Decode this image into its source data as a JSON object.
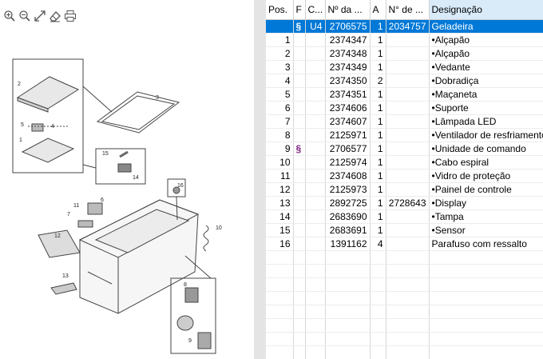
{
  "toolbar": {
    "icons": [
      "zoom-in-icon",
      "zoom-out-icon",
      "fit-icon",
      "eraser-icon",
      "print-icon"
    ]
  },
  "drawing": {
    "labels": [
      "2",
      "3",
      "5",
      "4",
      "1",
      "15",
      "14",
      "16",
      "6",
      "11",
      "7",
      "12",
      "10",
      "13",
      "8",
      "9"
    ]
  },
  "table": {
    "headers": [
      "Pos.",
      "F",
      "C...",
      "Nº da ...",
      "A",
      "N° de ...",
      "Designação"
    ],
    "rows": [
      {
        "pos": "",
        "f": "§",
        "c": "U4",
        "num": "2706575",
        "a": "1",
        "n2": "2034757",
        "desc": "Geladeira",
        "sel": true
      },
      {
        "pos": "1",
        "f": "",
        "c": "",
        "num": "2374347",
        "a": "1",
        "n2": "",
        "desc": "•Alçapão"
      },
      {
        "pos": "2",
        "f": "",
        "c": "",
        "num": "2374348",
        "a": "1",
        "n2": "",
        "desc": "•Alçapão"
      },
      {
        "pos": "3",
        "f": "",
        "c": "",
        "num": "2374349",
        "a": "1",
        "n2": "",
        "desc": "•Vedante"
      },
      {
        "pos": "4",
        "f": "",
        "c": "",
        "num": "2374350",
        "a": "2",
        "n2": "",
        "desc": "•Dobradiça"
      },
      {
        "pos": "5",
        "f": "",
        "c": "",
        "num": "2374351",
        "a": "1",
        "n2": "",
        "desc": "•Maçaneta"
      },
      {
        "pos": "6",
        "f": "",
        "c": "",
        "num": "2374606",
        "a": "1",
        "n2": "",
        "desc": "•Suporte"
      },
      {
        "pos": "7",
        "f": "",
        "c": "",
        "num": "2374607",
        "a": "1",
        "n2": "",
        "desc": "•Lâmpada LED"
      },
      {
        "pos": "8",
        "f": "",
        "c": "",
        "num": "2125971",
        "a": "1",
        "n2": "",
        "desc": "•Ventilador de resfriamento"
      },
      {
        "pos": "9",
        "f": "§",
        "c": "",
        "num": "2706577",
        "a": "1",
        "n2": "",
        "desc": "•Unidade de comando"
      },
      {
        "pos": "10",
        "f": "",
        "c": "",
        "num": "2125974",
        "a": "1",
        "n2": "",
        "desc": "•Cabo espiral"
      },
      {
        "pos": "11",
        "f": "",
        "c": "",
        "num": "2374608",
        "a": "1",
        "n2": "",
        "desc": "•Vidro de proteção"
      },
      {
        "pos": "12",
        "f": "",
        "c": "",
        "num": "2125973",
        "a": "1",
        "n2": "",
        "desc": "•Painel de controle"
      },
      {
        "pos": "13",
        "f": "",
        "c": "",
        "num": "2892725",
        "a": "1",
        "n2": "2728643",
        "desc": "•Display"
      },
      {
        "pos": "14",
        "f": "",
        "c": "",
        "num": "2683690",
        "a": "1",
        "n2": "",
        "desc": "•Tampa"
      },
      {
        "pos": "15",
        "f": "",
        "c": "",
        "num": "2683691",
        "a": "1",
        "n2": "",
        "desc": "•Sensor"
      },
      {
        "pos": "16",
        "f": "",
        "c": "",
        "num": "1391162",
        "a": "4",
        "n2": "",
        "desc": "Parafuso com ressalto"
      }
    ]
  },
  "colors": {
    "selection": "#0078d7",
    "sorted_header": "#d9ebf9",
    "paragraph_mark": "#7a1f7a"
  }
}
